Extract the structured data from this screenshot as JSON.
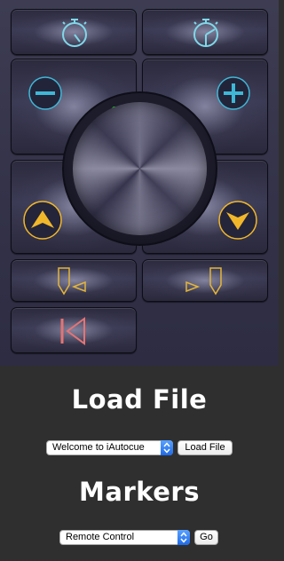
{
  "controls": {
    "stopwatch_left": {
      "icon": "stopwatch-icon",
      "color": "#7fd8e8"
    },
    "stopwatch_right": {
      "icon": "stopwatch-icon",
      "color": "#7fd8e8"
    },
    "minus": {
      "icon": "minus-circle-icon",
      "color": "#3fb7d6"
    },
    "plus": {
      "icon": "plus-circle-icon",
      "color": "#3fb7d6"
    },
    "play": {
      "icon": "play-icon",
      "color": "#19e21a"
    },
    "scroll_up": {
      "icon": "arrow-up-circle-icon",
      "color": "#f1b72a"
    },
    "scroll_down": {
      "icon": "arrow-down-circle-icon",
      "color": "#f1b72a"
    },
    "marker_left": {
      "icon": "marker-left-icon",
      "color": "#e4b53a"
    },
    "marker_right": {
      "icon": "marker-right-icon",
      "color": "#e4b53a"
    },
    "rewind": {
      "icon": "skip-to-start-icon",
      "color": "#e57474"
    }
  },
  "load_file": {
    "title": "Load File",
    "selected_file": "Welcome to iAutocue",
    "button_label": "Load File"
  },
  "markers": {
    "title": "Markers",
    "selected_marker": "Remote Control",
    "button_label": "Go"
  }
}
